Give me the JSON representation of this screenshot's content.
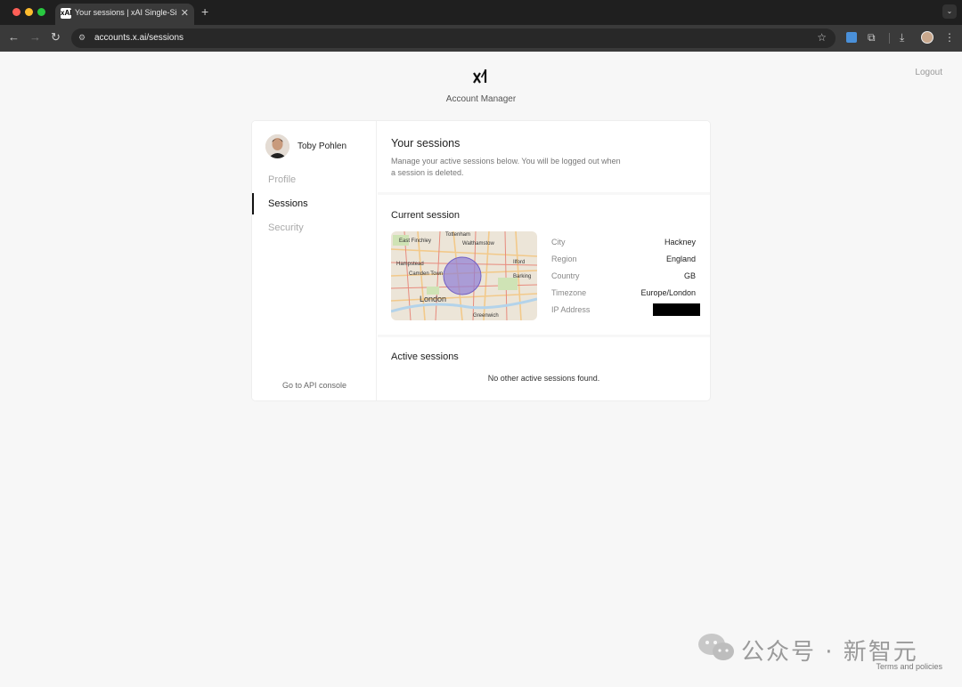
{
  "browser": {
    "tab_title": "Your sessions | xAI Single-Sign-On",
    "tab_favicon": "xAI",
    "url": "accounts.x.ai/sessions"
  },
  "header": {
    "logo": "xAI",
    "app_title": "Account Manager",
    "logout_label": "Logout"
  },
  "sidebar": {
    "user_name": "Toby Pohlen",
    "items": [
      {
        "label": "Profile"
      },
      {
        "label": "Sessions"
      },
      {
        "label": "Security"
      }
    ],
    "active_item": "Sessions",
    "api_console_label": "Go to API console"
  },
  "main": {
    "title": "Your sessions",
    "description": "Manage your active sessions below. You will be logged out when a session is deleted.",
    "current_session": {
      "heading": "Current session",
      "map_labels": [
        "East Finchley",
        "Tottenham",
        "Walthamstow",
        "Hampstead",
        "Ilford",
        "Camden Town",
        "Barking",
        "London",
        "Greenwich"
      ],
      "fields": [
        {
          "label": "City",
          "value": "Hackney"
        },
        {
          "label": "Region",
          "value": "England"
        },
        {
          "label": "Country",
          "value": "GB"
        },
        {
          "label": "Timezone",
          "value": "Europe/London"
        },
        {
          "label": "IP Address",
          "value": ""
        }
      ]
    },
    "active_sessions": {
      "heading": "Active sessions",
      "empty_message": "No other active sessions found."
    }
  },
  "footer": {
    "terms_label": "Terms and policies",
    "watermark": "公众号 · 新智元"
  },
  "colors": {
    "page_bg": "#f7f7f7",
    "card_bg": "#ffffff",
    "chrome_bg": "#1f1f1f",
    "map_marker": "#8f7dd6"
  }
}
